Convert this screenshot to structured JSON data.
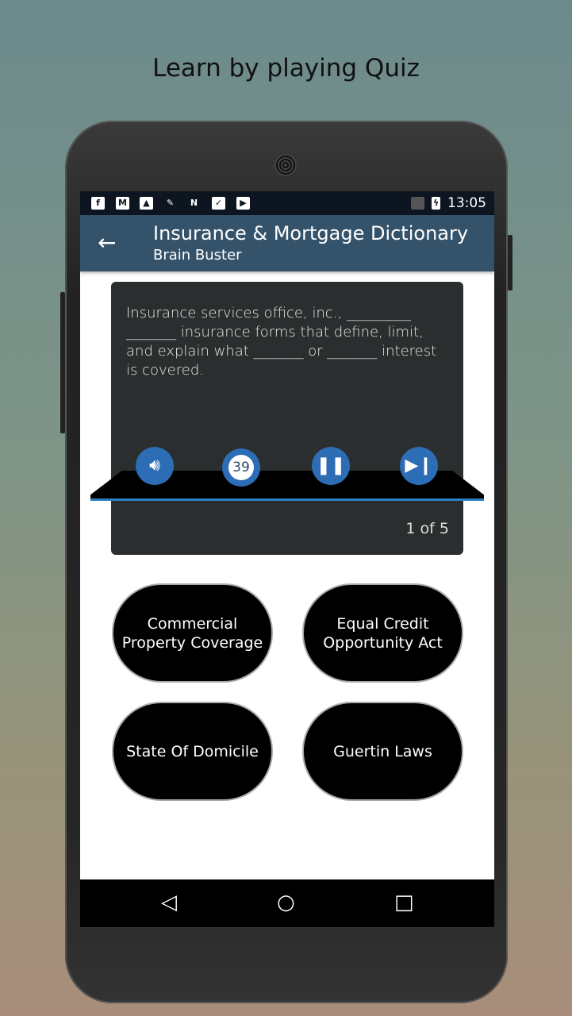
{
  "headline": "Learn by playing Quiz",
  "status_bar": {
    "time": "13:05",
    "left_icons": [
      "facebook-icon",
      "gmail-icon",
      "gallery-icon",
      "cleaner-icon",
      "n-app-icon",
      "clipboard-check-icon",
      "play-store-icon"
    ],
    "right_icons": [
      "no-sim-icon",
      "battery-charging-icon"
    ]
  },
  "app_bar": {
    "title": "Insurance & Mortgage Dictionary",
    "subtitle": "Brain Buster",
    "back_icon": "arrow-left-icon"
  },
  "question": {
    "text": "Insurance services office, inc., _________ _______ insurance forms that define, limit, and explain what _______ or _______ interest is covered.",
    "timer": "39",
    "progress": "1 of 5"
  },
  "controls": [
    "speaker-icon",
    "stopwatch-icon",
    "pause-icon",
    "skip-next-icon"
  ],
  "answers": [
    "Commercial Property Coverage",
    "Equal Credit Opportunity Act",
    "State Of Domicile",
    "Guertin Laws"
  ],
  "colors": {
    "app_bar": "#34536b",
    "accent": "#2d6db5",
    "card": "#2b2e2f"
  }
}
